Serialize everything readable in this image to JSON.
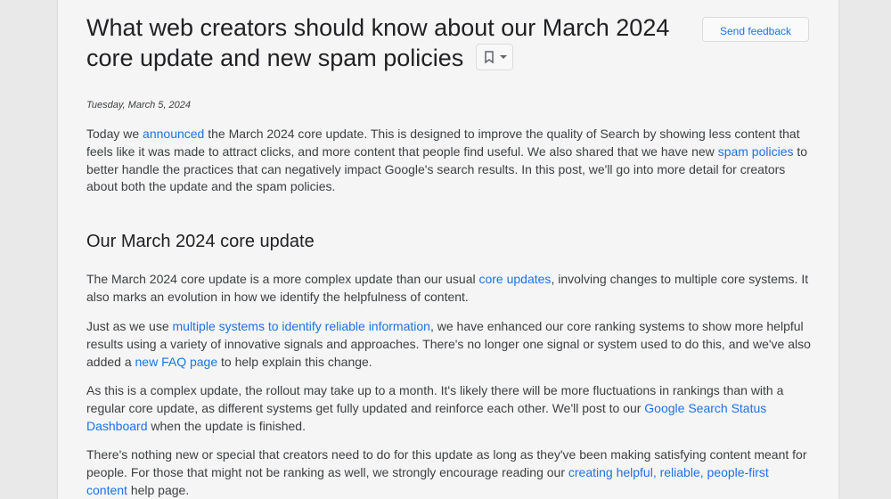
{
  "article": {
    "title_line1": "What web creators should know about our March 2024",
    "title_line2": "core update and new spam policies",
    "date": "Tuesday, March 5, 2024",
    "feedback_label": "Send feedback"
  },
  "icons": {
    "bookmark": "bookmark-icon",
    "menu": "chevron-down-icon"
  },
  "colors": {
    "link": "#1a73e8",
    "text": "#3c4043",
    "heading": "#202124"
  },
  "intro": {
    "t1": "Today we ",
    "l1": "announced",
    "t2": " the March 2024 core update. This is designed to improve the quality of Search by showing less content that feels like it was made to attract clicks, and more content that people find useful. We also shared that we have new ",
    "l2": "spam policies",
    "t3": " to better handle the practices that can negatively impact Google's search results. In this post, we'll go into more detail for creators about both the update and the spam policies."
  },
  "section": {
    "heading": "Our March 2024 core update",
    "p1": {
      "t1": "The March 2024 core update is a more complex update than our usual ",
      "l1": "core updates",
      "t2": ", involving changes to multiple core systems. It also marks an evolution in how we identify the helpfulness of content."
    },
    "p2": {
      "t1": "Just as we use ",
      "l1": "multiple systems to identify reliable information",
      "t2": ", we have enhanced our core ranking systems to show more helpful results using a variety of innovative signals and approaches. There's no longer one signal or system used to do this, and we've also added a ",
      "l2": "new FAQ page",
      "t3": " to help explain this change."
    },
    "p3": {
      "t1": "As this is a complex update, the rollout may take up to a month. It's likely there will be more fluctuations in rankings than with a regular core update, as different systems get fully updated and reinforce each other. We'll post to our ",
      "l1": "Google Search Status Dashboard",
      "t2": " when the update is finished."
    },
    "p4": {
      "t1": "There's nothing new or special that creators need to do for this update as long as they've been making satisfying content meant for people. For those that might not be ranking as well, we strongly encourage reading our ",
      "l1": "creating helpful, reliable, people-first content",
      "t2": " help page."
    }
  }
}
